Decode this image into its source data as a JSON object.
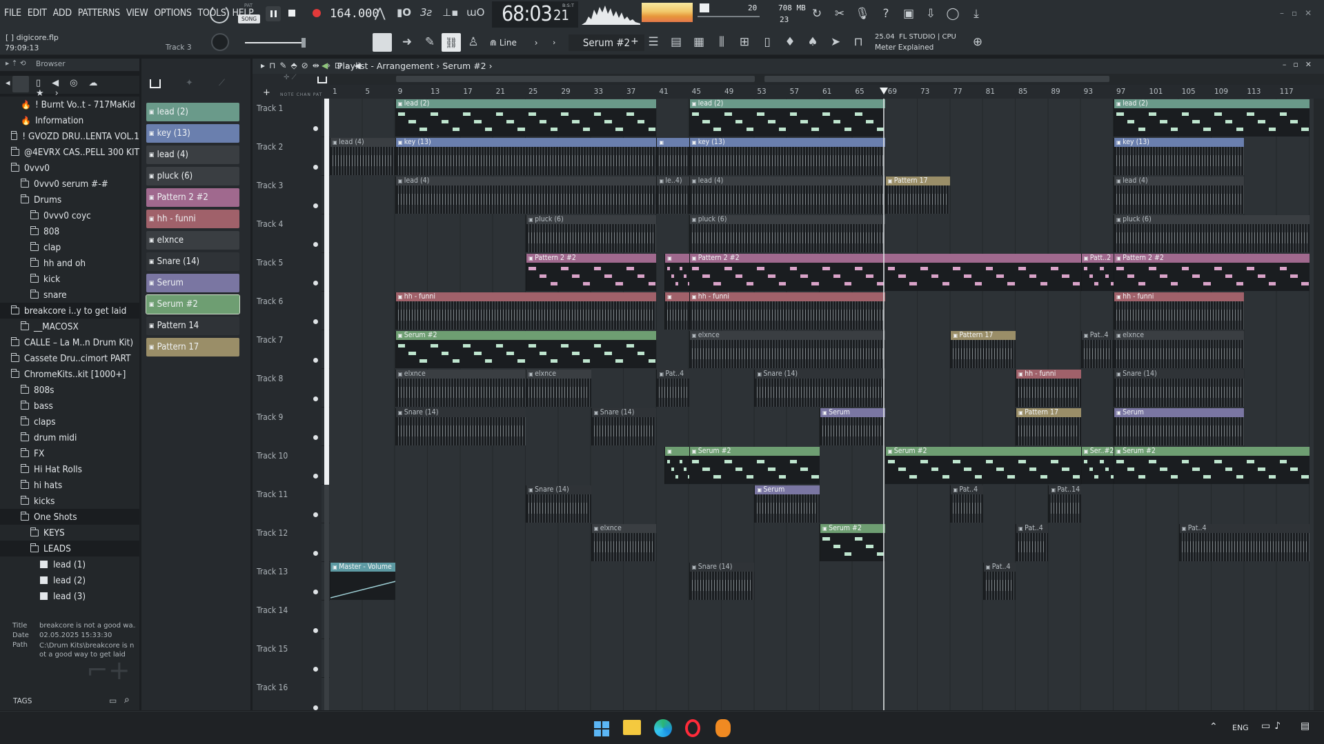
{
  "menu": [
    "FILE",
    "EDIT",
    "ADD",
    "PATTERNS",
    "VIEW",
    "OPTIONS",
    "TOOLS",
    "HELP"
  ],
  "transport": {
    "pat_label": "PAT",
    "song_label": "SONG",
    "tempo": "164.000",
    "time": "68:03",
    "time_ticks": "21",
    "time_unit": "B:S:T"
  },
  "monitor": {
    "cpu_voices": "20",
    "polyphony": "23",
    "memory": "708 MB"
  },
  "project": {
    "file": "digicore.flp",
    "elapsed": "79:09:13",
    "hint_track": "Track 3"
  },
  "toolbar": {
    "snap": "Line",
    "current_pattern": "Serum #2",
    "news_version": "25.04",
    "news_title": "FL STUDIO | CPU",
    "news_sub": "Meter Explained"
  },
  "browser": {
    "title": "Browser",
    "items": [
      {
        "label": "! Burnt Vo..t - 717MaKid",
        "indent": 1,
        "kind": "fire"
      },
      {
        "label": "Information",
        "indent": 1,
        "kind": "fire"
      },
      {
        "label": "! GVOZD DRU..LENTA VOL.1",
        "indent": 0,
        "kind": "folder"
      },
      {
        "label": "@4EVRX CAS..PELL 300 KIT",
        "indent": 0,
        "kind": "folder"
      },
      {
        "label": "0vvv0",
        "indent": 0,
        "kind": "folder"
      },
      {
        "label": "0vvv0 serum #-#",
        "indent": 1,
        "kind": "folder"
      },
      {
        "label": "Drums",
        "indent": 1,
        "kind": "folder"
      },
      {
        "label": "0vvv0 coyc",
        "indent": 2,
        "kind": "folder"
      },
      {
        "label": "808",
        "indent": 2,
        "kind": "folder"
      },
      {
        "label": "clap",
        "indent": 2,
        "kind": "folder"
      },
      {
        "label": "hh and oh",
        "indent": 2,
        "kind": "folder"
      },
      {
        "label": "kick",
        "indent": 2,
        "kind": "folder"
      },
      {
        "label": "snare",
        "indent": 2,
        "kind": "folder"
      },
      {
        "label": "breakcore i..y to get laid",
        "indent": 0,
        "kind": "folder"
      },
      {
        "label": "__MACOSX",
        "indent": 1,
        "kind": "folder"
      },
      {
        "label": "CALLE – La M..n Drum Kit)",
        "indent": 0,
        "kind": "folder"
      },
      {
        "label": "Cassete Dru..cimort PART",
        "indent": 0,
        "kind": "folder"
      },
      {
        "label": "ChromeKits..kit [1000+]",
        "indent": 0,
        "kind": "folder"
      },
      {
        "label": "808s",
        "indent": 1,
        "kind": "folder"
      },
      {
        "label": "bass",
        "indent": 1,
        "kind": "folder"
      },
      {
        "label": "claps",
        "indent": 1,
        "kind": "folder"
      },
      {
        "label": "drum midi",
        "indent": 1,
        "kind": "folder"
      },
      {
        "label": "FX",
        "indent": 1,
        "kind": "folder"
      },
      {
        "label": "Hi Hat Rolls",
        "indent": 1,
        "kind": "folder"
      },
      {
        "label": "hi hats",
        "indent": 1,
        "kind": "folder"
      },
      {
        "label": "kicks",
        "indent": 1,
        "kind": "folder"
      },
      {
        "label": "One Shots",
        "indent": 1,
        "kind": "folder"
      },
      {
        "label": "KEYS",
        "indent": 2,
        "kind": "folder"
      },
      {
        "label": "LEADS",
        "indent": 2,
        "kind": "folder"
      },
      {
        "label": "lead (1)",
        "indent": 3,
        "kind": "note"
      },
      {
        "label": "lead (2)",
        "indent": 3,
        "kind": "note"
      },
      {
        "label": "lead (3)",
        "indent": 3,
        "kind": "note"
      }
    ],
    "info_title_label": "Title",
    "info_title": "breakcore is not a good wa..",
    "info_date_label": "Date",
    "info_date": "02.05.2025 15:33:30",
    "info_path_label": "Path",
    "info_path": "C:\\Drum Kits\\breakcore is not a good way to get laid",
    "tags_label": "TAGS"
  },
  "patterns": [
    {
      "label": "lead (2)",
      "color": "#6a9a8a"
    },
    {
      "label": "key (13)",
      "color": "#6a7fae"
    },
    {
      "label": "lead (4)",
      "color": "#3a3e42"
    },
    {
      "label": "pluck (6)",
      "color": "#3a3e42"
    },
    {
      "label": "Pattern 2 #2",
      "color": "#a0698e"
    },
    {
      "label": "hh - funni",
      "color": "#a0616a"
    },
    {
      "label": "elxnce",
      "color": "#3a3e42"
    },
    {
      "label": "Snare (14)",
      "color": "#2f3337"
    },
    {
      "label": "Serum",
      "color": "#7a76a2"
    },
    {
      "label": "Serum #2",
      "color": "#6e9e72"
    },
    {
      "label": "Pattern 14",
      "color": "#2f3337"
    },
    {
      "label": "Pattern 17",
      "color": "#9a8e68"
    }
  ],
  "playlist": {
    "title": "Playlist - Arrangement",
    "pattern": "Serum #2",
    "ruler": [
      "1",
      "5",
      "9",
      "13",
      "17",
      "21",
      "25",
      "29",
      "33",
      "37",
      "41",
      "45",
      "49",
      "53",
      "57",
      "61",
      "65",
      "69",
      "73",
      "77",
      "81",
      "85",
      "89",
      "93",
      "97",
      "101",
      "105",
      "109",
      "113",
      "117"
    ],
    "tracks": [
      "Track 1",
      "Track 2",
      "Track 3",
      "Track 4",
      "Track 5",
      "Track 6",
      "Track 7",
      "Track 8",
      "Track 9",
      "Track 10",
      "Track 11",
      "Track 12",
      "Track 13",
      "Track 14",
      "Track 15",
      "Track 16"
    ],
    "clips": [
      {
        "t": 0,
        "s": 9,
        "e": 41,
        "l": "lead (2)",
        "c": "#6a9a8a",
        "k": "notes",
        "n": 4
      },
      {
        "t": 0,
        "s": 45,
        "e": 69,
        "l": "lead (2)",
        "c": "#6a9a8a",
        "k": "notes",
        "n": 3
      },
      {
        "t": 0,
        "s": 97,
        "e": 121,
        "l": "lead (2)",
        "c": "#6a9a8a",
        "k": "notes",
        "n": 3
      },
      {
        "t": 1,
        "s": 1,
        "e": 9,
        "l": "lead (4)",
        "c": "#3a3e42",
        "k": "dense",
        "n": 1
      },
      {
        "t": 1,
        "s": 9,
        "e": 41,
        "l": "key (13)",
        "c": "#6a7fae",
        "k": "dense",
        "n": 4
      },
      {
        "t": 1,
        "s": 41,
        "e": 45,
        "l": "",
        "c": "#6a7fae",
        "k": "dense",
        "n": 2
      },
      {
        "t": 1,
        "s": 45,
        "e": 69,
        "l": "key (13)",
        "c": "#6a7fae",
        "k": "dense",
        "n": 3
      },
      {
        "t": 1,
        "s": 97,
        "e": 113,
        "l": "key (13)",
        "c": "#6a7fae",
        "k": "dense",
        "n": 2
      },
      {
        "t": 2,
        "s": 9,
        "e": 41,
        "l": "lead (4)",
        "c": "#3a3e42",
        "k": "dense",
        "n": 4
      },
      {
        "t": 2,
        "s": 41,
        "e": 45,
        "l": "le..4)",
        "c": "#3a3e42",
        "k": "dense",
        "n": 1
      },
      {
        "t": 2,
        "s": 45,
        "e": 69,
        "l": "lead (4)",
        "c": "#3a3e42",
        "k": "dense",
        "n": 3
      },
      {
        "t": 2,
        "s": 69,
        "e": 77,
        "l": "Pattern 17",
        "c": "#9a8e68",
        "k": "dense",
        "n": 1
      },
      {
        "t": 2,
        "s": 97,
        "e": 113,
        "l": "lead (4)",
        "c": "#3a3e42",
        "k": "dense",
        "n": 2
      },
      {
        "t": 3,
        "s": 25,
        "e": 41,
        "l": "pluck (6)",
        "c": "#3a3e42",
        "k": "dense",
        "n": 2
      },
      {
        "t": 3,
        "s": 45,
        "e": 69,
        "l": "pluck (6)",
        "c": "#3a3e42",
        "k": "dense",
        "n": 3
      },
      {
        "t": 3,
        "s": 97,
        "e": 121,
        "l": "pluck (6)",
        "c": "#3a3e42",
        "k": "dense",
        "n": 3
      },
      {
        "t": 4,
        "s": 25,
        "e": 41,
        "l": "Pattern 2 #2",
        "c": "#a0698e",
        "k": "notes",
        "n": 2
      },
      {
        "t": 4,
        "s": 42,
        "e": 45,
        "l": "",
        "c": "#a0698e",
        "k": "notes",
        "n": 1
      },
      {
        "t": 4,
        "s": 45,
        "e": 93,
        "l": "Pattern 2 #2",
        "c": "#a0698e",
        "k": "notes",
        "n": 6
      },
      {
        "t": 4,
        "s": 93,
        "e": 97,
        "l": "Patt..2",
        "c": "#a0698e",
        "k": "notes",
        "n": 1
      },
      {
        "t": 4,
        "s": 97,
        "e": 121,
        "l": "Pattern 2 #2",
        "c": "#a0698e",
        "k": "notes",
        "n": 3
      },
      {
        "t": 5,
        "s": 9,
        "e": 41,
        "l": "hh - funni",
        "c": "#a0616a",
        "k": "dense",
        "n": 4
      },
      {
        "t": 5,
        "s": 42,
        "e": 45,
        "l": "",
        "c": "#a0616a",
        "k": "dense",
        "n": 1
      },
      {
        "t": 5,
        "s": 45,
        "e": 69,
        "l": "hh - funni",
        "c": "#a0616a",
        "k": "dense",
        "n": 3
      },
      {
        "t": 5,
        "s": 97,
        "e": 113,
        "l": "hh - funni",
        "c": "#a0616a",
        "k": "dense",
        "n": 2
      },
      {
        "t": 6,
        "s": 9,
        "e": 41,
        "l": "Serum #2",
        "c": "#6e9e72",
        "k": "notes",
        "n": 4
      },
      {
        "t": 6,
        "s": 45,
        "e": 69,
        "l": "elxnce",
        "c": "#3a3e42",
        "k": "dense",
        "n": 3
      },
      {
        "t": 6,
        "s": 77,
        "e": 85,
        "l": "Pattern 17",
        "c": "#9a8e68",
        "k": "dense",
        "n": 1
      },
      {
        "t": 6,
        "s": 93,
        "e": 97,
        "l": "Pat..4",
        "c": "#2f3337",
        "k": "dense",
        "n": 1
      },
      {
        "t": 6,
        "s": 97,
        "e": 113,
        "l": "elxnce",
        "c": "#3a3e42",
        "k": "dense",
        "n": 2
      },
      {
        "t": 7,
        "s": 9,
        "e": 25,
        "l": "elxnce",
        "c": "#3a3e42",
        "k": "dense",
        "n": 2
      },
      {
        "t": 7,
        "s": 25,
        "e": 33,
        "l": "elxnce",
        "c": "#3a3e42",
        "k": "dense",
        "n": 1
      },
      {
        "t": 7,
        "s": 41,
        "e": 45,
        "l": "Pat..4",
        "c": "#2f3337",
        "k": "dense",
        "n": 1
      },
      {
        "t": 7,
        "s": 53,
        "e": 69,
        "l": "Snare (14)",
        "c": "#2f3337",
        "k": "dense",
        "n": 2
      },
      {
        "t": 7,
        "s": 85,
        "e": 93,
        "l": "hh - funni",
        "c": "#a0616a",
        "k": "dense",
        "n": 1
      },
      {
        "t": 7,
        "s": 97,
        "e": 113,
        "l": "Snare (14)",
        "c": "#2f3337",
        "k": "dense",
        "n": 2
      },
      {
        "t": 8,
        "s": 9,
        "e": 25,
        "l": "Snare (14)",
        "c": "#2f3337",
        "k": "dense",
        "n": 2
      },
      {
        "t": 8,
        "s": 33,
        "e": 41,
        "l": "Snare (14)",
        "c": "#2f3337",
        "k": "dense",
        "n": 1
      },
      {
        "t": 8,
        "s": 61,
        "e": 69,
        "l": "Serum",
        "c": "#7a76a2",
        "k": "dense",
        "n": 1
      },
      {
        "t": 8,
        "s": 85,
        "e": 93,
        "l": "Pattern 17",
        "c": "#9a8e68",
        "k": "dense",
        "n": 1
      },
      {
        "t": 8,
        "s": 97,
        "e": 113,
        "l": "Serum",
        "c": "#7a76a2",
        "k": "dense",
        "n": 4
      },
      {
        "t": 9,
        "s": 42,
        "e": 45,
        "l": "",
        "c": "#6e9e72",
        "k": "notes",
        "n": 1
      },
      {
        "t": 9,
        "s": 45,
        "e": 61,
        "l": "Serum #2",
        "c": "#6e9e72",
        "k": "notes",
        "n": 2
      },
      {
        "t": 9,
        "s": 69,
        "e": 93,
        "l": "Serum #2",
        "c": "#6e9e72",
        "k": "notes",
        "n": 3
      },
      {
        "t": 9,
        "s": 93,
        "e": 97,
        "l": "Ser..#2",
        "c": "#6e9e72",
        "k": "notes",
        "n": 1
      },
      {
        "t": 9,
        "s": 97,
        "e": 121,
        "l": "Serum #2",
        "c": "#6e9e72",
        "k": "notes",
        "n": 3
      },
      {
        "t": 10,
        "s": 25,
        "e": 33,
        "l": "Snare (14)",
        "c": "#2f3337",
        "k": "dense",
        "n": 1
      },
      {
        "t": 10,
        "s": 53,
        "e": 61,
        "l": "Serum",
        "c": "#7a76a2",
        "k": "dense",
        "n": 1
      },
      {
        "t": 10,
        "s": 77,
        "e": 81,
        "l": "Pat..4",
        "c": "#2f3337",
        "k": "dense",
        "n": 1
      },
      {
        "t": 10,
        "s": 89,
        "e": 93,
        "l": "Pat..14",
        "c": "#2f3337",
        "k": "dense",
        "n": 1
      },
      {
        "t": 11,
        "s": 33,
        "e": 41,
        "l": "elxnce",
        "c": "#3a3e42",
        "k": "dense",
        "n": 1
      },
      {
        "t": 11,
        "s": 61,
        "e": 69,
        "l": "Serum #2",
        "c": "#6e9e72",
        "k": "notes",
        "n": 1
      },
      {
        "t": 11,
        "s": 85,
        "e": 89,
        "l": "Pat..4",
        "c": "#2f3337",
        "k": "dense",
        "n": 1
      },
      {
        "t": 11,
        "s": 105,
        "e": 121,
        "l": "Pat..4",
        "c": "#2f3337",
        "k": "dense",
        "n": 4
      },
      {
        "t": 12,
        "s": 1,
        "e": 9,
        "l": "Master - Volume",
        "c": "#5d9aa3",
        "k": "auto",
        "n": 1
      },
      {
        "t": 12,
        "s": 45,
        "e": 53,
        "l": "Snare (14)",
        "c": "#2f3337",
        "k": "dense",
        "n": 1
      },
      {
        "t": 12,
        "s": 81,
        "e": 85,
        "l": "Pat..4",
        "c": "#2f3337",
        "k": "dense",
        "n": 1
      }
    ]
  },
  "taskbar": {
    "lang": "ENG"
  }
}
